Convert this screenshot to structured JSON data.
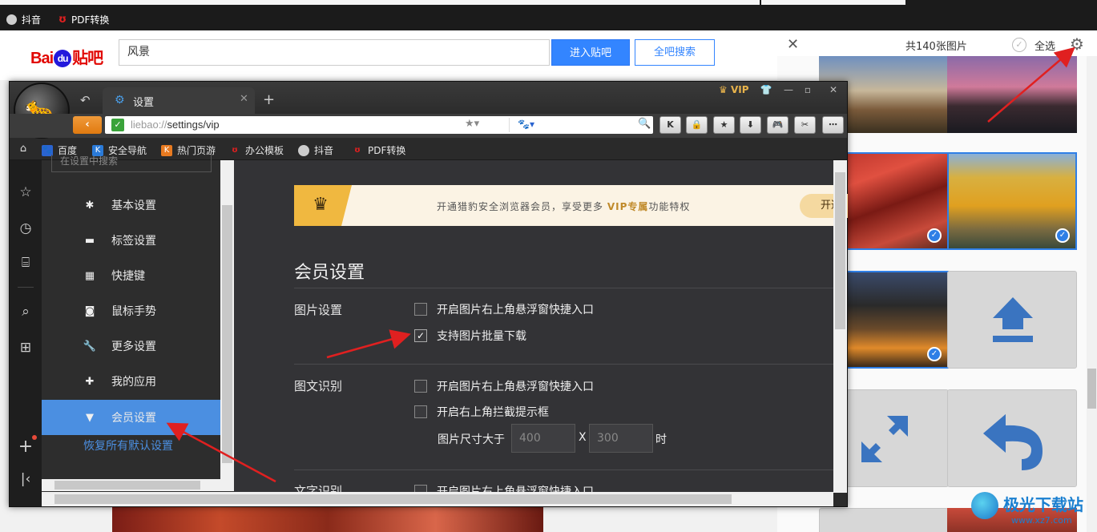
{
  "background": {
    "top_bookmarks": [
      "抖音",
      "PDF转换"
    ],
    "logo_text": {
      "pre": "Bai",
      "mid": "du",
      "post": "贴吧"
    },
    "search_value": "风景",
    "enter_btn": "进入贴吧",
    "search_all_btn": "全吧搜索"
  },
  "image_panel": {
    "count_text": "共140张图片",
    "select_all": "全选"
  },
  "browser": {
    "tab_title": "设置",
    "vip_badge": "VIP",
    "url_scheme": "liebao://",
    "url_path": "settings/vip",
    "bookmarks": [
      "百度",
      "安全导航",
      "热门页游",
      "办公模板",
      "抖音",
      "PDF转换"
    ]
  },
  "settings": {
    "search_placeholder": "在设置中搜索",
    "nav": [
      "基本设置",
      "标签设置",
      "快捷键",
      "鼠标手势",
      "更多设置",
      "我的应用",
      "会员设置"
    ],
    "reset": "恢复所有默认设置",
    "vip_banner": {
      "pre": "开通猎豹安全浏览器会员，享受更多 ",
      "hl": "VIP专属",
      "post": "功能特权",
      "button": "开通"
    },
    "section_title": "会员设置",
    "groups": {
      "image": {
        "label": "图片设置",
        "opt1": "开启图片右上角悬浮窗快捷入口",
        "opt2": "支持图片批量下载"
      },
      "ocr": {
        "label": "图文识别",
        "opt1": "开启图片右上角悬浮窗快捷入口",
        "opt2": "开启右上角拦截提示框",
        "size_label": "图片尺寸大于",
        "w": "400",
        "x": "X",
        "h": "300",
        "unit": "时"
      },
      "text": {
        "label": "文字识别",
        "opt1": "开启图片右上角悬浮窗快捷入口"
      }
    },
    "checked": {
      "image_opt1": false,
      "image_opt2": true,
      "ocr_opt1": false,
      "ocr_opt2": false,
      "text_opt1": false
    }
  },
  "watermark": {
    "name": "极光下载站",
    "url": "www.xz7.com"
  },
  "colors": {
    "accent": "#4b8fe1",
    "arrow": "#e02020",
    "vip_gold": "#f0b840"
  }
}
